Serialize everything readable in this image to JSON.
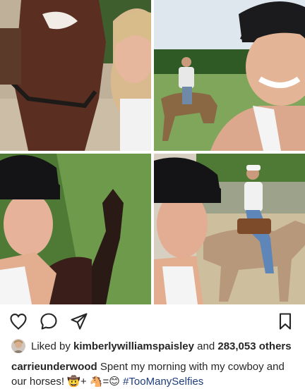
{
  "post": {
    "likes": {
      "prefix": "Liked by",
      "user": "kimberlywilliamspaisley",
      "middle": "and",
      "count": "283,053 others"
    },
    "caption": {
      "username": "carrieunderwood",
      "text": "Spent my morning with my cowboy and our horses!",
      "emoji_line": "🤠+ 🐴=😊",
      "hashtag": "#TooManySelfies"
    }
  },
  "icons": {
    "heart": "heart-icon",
    "comment": "comment-icon",
    "share": "share-icon",
    "save": "bookmark-icon"
  }
}
